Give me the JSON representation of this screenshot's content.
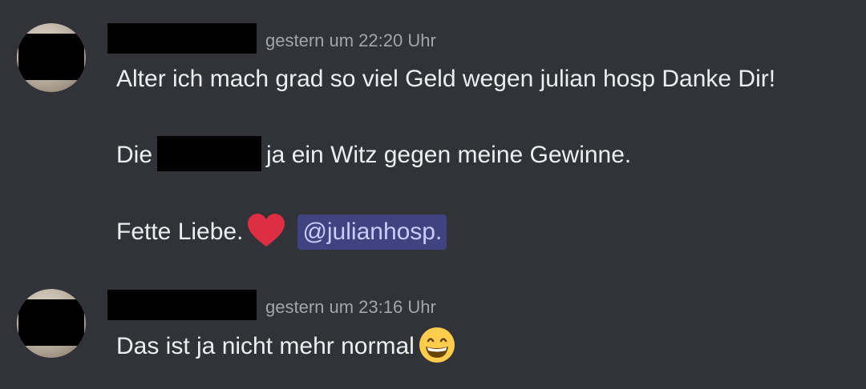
{
  "messages": [
    {
      "timestamp": "gestern um 22:20 Uhr",
      "lines": {
        "l1": "Alter ich mach grad so viel Geld wegen julian hosp Danke Dir!",
        "l2_before": "Die",
        "l2_after": "ja ein Witz gegen meine Gewinne.",
        "l3_text": "Fette Liebe.",
        "l3_mention": "@julianhosp."
      },
      "icons": [
        "heart-icon"
      ]
    },
    {
      "timestamp": "gestern um 23:16 Uhr",
      "lines": {
        "l1": "Das ist ja nicht mehr normal"
      },
      "icons": [
        "grinning-face-icon"
      ]
    }
  ],
  "colors": {
    "background": "#323339",
    "text": "#eceef0",
    "timestamp": "#a2a5ab",
    "mention_bg": "#3f4380",
    "mention_text": "#c9cdfb",
    "heart": "#dd2e44"
  }
}
